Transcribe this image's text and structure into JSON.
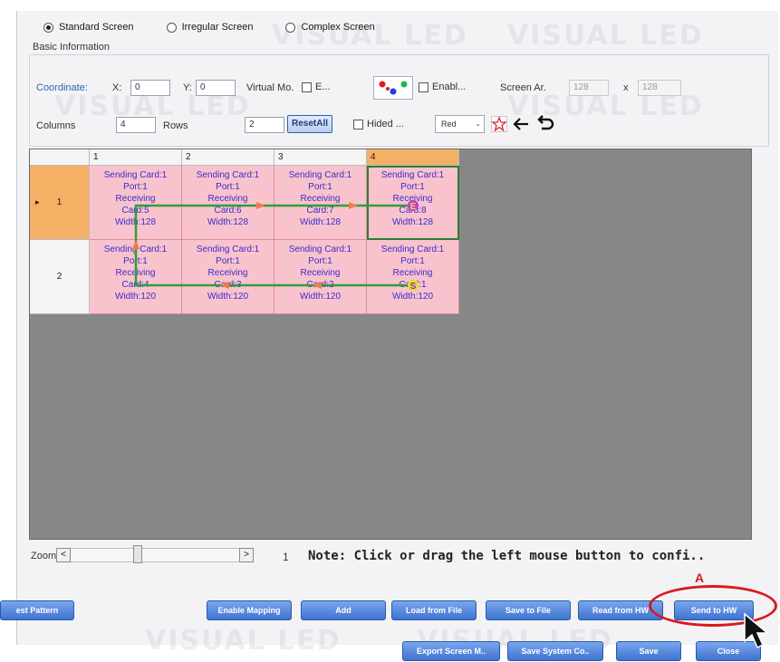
{
  "screen_types": [
    {
      "label": "Standard Screen",
      "selected": true
    },
    {
      "label": "Irregular Screen",
      "selected": false
    },
    {
      "label": "Complex Screen",
      "selected": false
    }
  ],
  "basic_info": {
    "title": "Basic Information",
    "coordinate_label": "Coordinate:",
    "x_label": "X:",
    "x_value": "0",
    "y_label": "Y:",
    "y_value": "0",
    "virtual_mode_label": "Virtual Mo.",
    "e_checkbox_label": "E...",
    "enable_checkbox_label": "Enabl...",
    "screen_area_label": "Screen Ar.",
    "screen_area_w": "128",
    "screen_area_x": "x",
    "screen_area_h": "128",
    "columns_label": "Columns",
    "columns_value": "4",
    "rows_label": "Rows",
    "rows_value": "2",
    "reset_all_label": "ResetAll",
    "hided_label": "Hided ...",
    "color_select_value": "Red"
  },
  "grid": {
    "column_headers": [
      "1",
      "2",
      "3",
      "4"
    ],
    "selected_column": 4,
    "row_headers": [
      "1",
      "2"
    ],
    "selected_row": 1,
    "row_marker": "▸",
    "rows": [
      [
        {
          "line1": "Sending Card:1",
          "line2": "Port:1",
          "line3": "Receiving",
          "line4": "Card:5",
          "line5": "Width:128"
        },
        {
          "line1": "Sending Card:1",
          "line2": "Port:1",
          "line3": "Receiving",
          "line4": "Card:6",
          "line5": "Width:128"
        },
        {
          "line1": "Sending Card:1",
          "line2": "Port:1",
          "line3": "Receiving",
          "line4": "Card:7",
          "line5": "Width:128"
        },
        {
          "line1": "Sending Card:1",
          "line2": "Port:1",
          "line3": "Receiving",
          "line4": "Card:8",
          "line5": "Width:128"
        }
      ],
      [
        {
          "line1": "Sending Card:1",
          "line2": "Port:1",
          "line3": "Receiving",
          "line4": "Card:4",
          "line5": "Width:120"
        },
        {
          "line1": "Sending Card:1",
          "line2": "Port:1",
          "line3": "Receiving",
          "line4": "Card:3",
          "line5": "Width:120"
        },
        {
          "line1": "Sending Card:1",
          "line2": "Port:1",
          "line3": "Receiving",
          "line4": "Card:2",
          "line5": "Width:120"
        },
        {
          "line1": "Sending Card:1",
          "line2": "Port:1",
          "line3": "Receiving",
          "line4": "Card:1",
          "line5": "Width:120"
        }
      ]
    ],
    "start_marker": "S",
    "end_marker": "E"
  },
  "zoom": {
    "label": "Zoom",
    "left_arrow": "<",
    "right_arrow": ">",
    "value": "1"
  },
  "note": "Note: Click or drag the left mouse button to confi..",
  "buttons_row1": [
    "est Pattern",
    "Enable Mapping",
    "Add",
    "Load from File",
    "Save to File",
    "Read from HW",
    "Send to HW"
  ],
  "buttons_row2": [
    "Export Screen M..",
    "Save System Co..",
    "Save",
    "Close"
  ],
  "annotation_letter": "A",
  "watermark_text": "VISUAL LED",
  "colors": {
    "cell_fill": "#f9c3ce",
    "selected_header": "#f5b066",
    "grid_bg": "#868788",
    "button_blue": "#3e73d0",
    "annotation_red": "#d8191e",
    "route_line": "#2e9e3a"
  }
}
